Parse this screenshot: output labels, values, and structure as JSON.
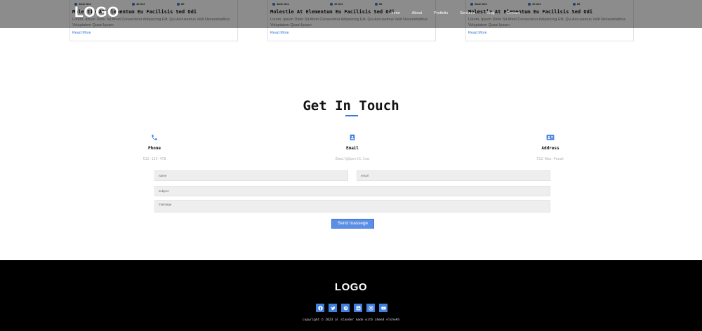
{
  "navbar": {
    "logo": "LOGO",
    "links": [
      "Home",
      "About",
      "Protfolio",
      "Services",
      "Blog",
      "Contact"
    ]
  },
  "blog": {
    "cards": [
      {
        "author": "Jane Deo",
        "date": "10 Oct",
        "count": "80",
        "title": "Molestie At Elementum Eu Facilisis Sed Odi",
        "text": "Lorem, Ipsum Dolor Sit Amet Consectetur Adipisicing Elit. Qui Accusamus Velit Necessitatibus Voluptatem Quasi Ipsam",
        "more": "Read More"
      },
      {
        "author": "Jane Deo",
        "date": "10 Oct",
        "count": "80",
        "title": "Molestie At Elementum Eu Facilisis Sed Odi",
        "text": "Lorem, Ipsum Dolor Sit Amet Consectetur Adipisicing Elit. Qui Accusamus Velit Necessitatibus Voluptatem Quasi Ipsam",
        "more": "Read More"
      },
      {
        "author": "Jane Deo",
        "date": "10 Oct",
        "count": "80",
        "title": "Molestie At Elementum Eu Facilisis Sed Odi",
        "text": "Lorem, Ipsum Dolor Sit Amet Consectetur Adipisicing Elit. Qui Accusamus Velit Necessitatibus Voluptatem Quasi Ipsam",
        "more": "Read More"
      }
    ]
  },
  "contact": {
    "title": "Get In Touch",
    "info": [
      {
        "icon": "phone-icon",
        "label": "Phone",
        "value": "512-125-478"
      },
      {
        "icon": "contact-card-icon",
        "label": "Email",
        "value": "Email@SpertS.Com"
      },
      {
        "icon": "address-card-icon",
        "label": "Address",
        "value": "512-Kmu-Poeat"
      }
    ],
    "form": {
      "name_placeholder": "name",
      "email_placeholder": "email",
      "subject_placeholder": "subject",
      "message_placeholder": "massage",
      "send_label": "Send massege"
    }
  },
  "footer": {
    "logo": "LOGO",
    "socials": [
      "facebook-icon",
      "twitter-icon",
      "pinterest-icon",
      "linkedin-icon",
      "instagram-icon",
      "youtube-icon"
    ],
    "copyright": "copyright © 2023 al stander made with ahmed elshekh"
  },
  "colors": {
    "accent": "#3f7fe0",
    "footer_bg": "#000000",
    "nav_overlay": "#737373"
  }
}
